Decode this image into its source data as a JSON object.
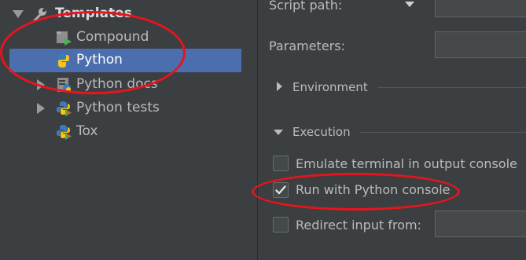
{
  "tree": {
    "root_label": "Templates",
    "items": [
      {
        "label": "Compound",
        "icon": "compound-run-icon"
      },
      {
        "label": "Python",
        "icon": "python-icon",
        "selected": true
      },
      {
        "label": "Python docs",
        "icon": "python-docs-icon"
      },
      {
        "label": "Python tests",
        "icon": "python-tests-icon"
      },
      {
        "label": "Tox",
        "icon": "tox-icon"
      }
    ]
  },
  "form": {
    "script_path_label": "Script path:",
    "parameters_label": "Parameters:",
    "environment_label": "Environment",
    "execution_label": "Execution",
    "emulate_terminal_label": "Emulate terminal in output console",
    "emulate_terminal_checked": false,
    "run_console_label": "Run with Python console",
    "run_console_checked": true,
    "redirect_input_label": "Redirect input from:",
    "redirect_input_checked": false
  },
  "colors": {
    "selection": "#4b6eaf",
    "annotation": "#e8141d",
    "background": "#3c3f41"
  }
}
